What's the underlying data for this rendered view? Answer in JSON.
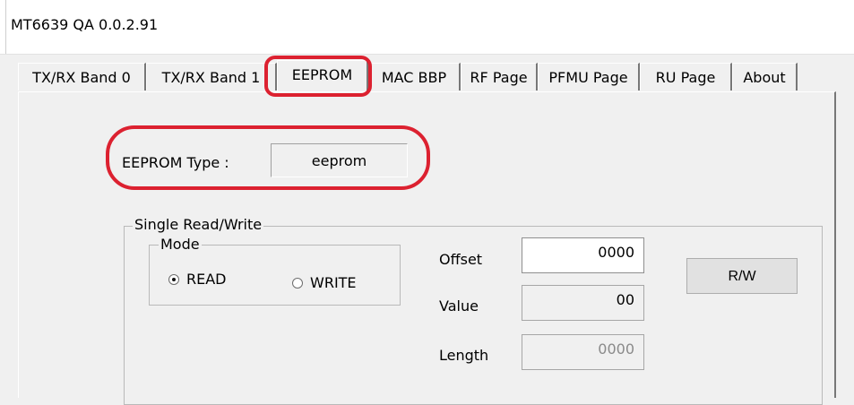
{
  "window": {
    "title": "MT6639 QA 0.0.2.91"
  },
  "tabs": [
    {
      "label": "TX/RX Band 0"
    },
    {
      "label": "TX/RX Band 1"
    },
    {
      "label": "EEPROM",
      "active": true
    },
    {
      "label": "MAC BBP"
    },
    {
      "label": "RF Page"
    },
    {
      "label": "PFMU Page"
    },
    {
      "label": "RU Page"
    },
    {
      "label": "About"
    }
  ],
  "eeprom_type": {
    "label": "EEPROM Type :",
    "value": "eeprom"
  },
  "single_rw": {
    "title": "Single Read/Write",
    "mode": {
      "title": "Mode",
      "read_label": "READ",
      "write_label": "WRITE",
      "selected": "READ"
    },
    "offset": {
      "label": "Offset",
      "value": "0000"
    },
    "value": {
      "label": "Value",
      "value": "00"
    },
    "length": {
      "label": "Length",
      "value": "0000"
    },
    "button_label": "R/W"
  },
  "colors": {
    "highlight": "#dc2130",
    "background": "#f0f0f0"
  }
}
